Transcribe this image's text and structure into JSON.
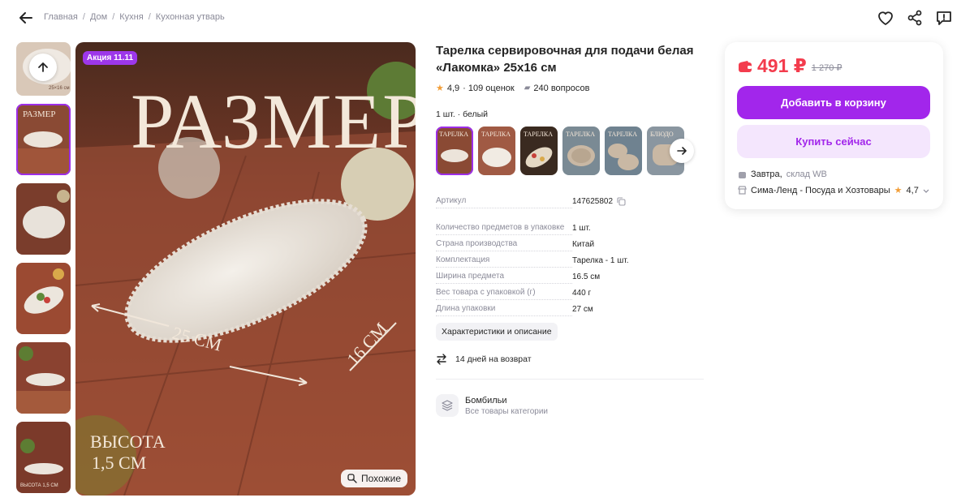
{
  "breadcrumb": {
    "items": [
      "Главная",
      "Дом",
      "Кухня",
      "Кухонная утварь"
    ]
  },
  "gallery": {
    "promo_badge": "Акция 11.11",
    "similar_label": "Похожие",
    "main_overlay": {
      "headline": "РАЗМЕР",
      "dim_length": "25 СМ",
      "dim_width": "16 СМ",
      "height_label": "ВЫСОТА",
      "height_value": "1,5 СМ"
    },
    "thumb_overlays": [
      "25×16 см",
      "РАЗМЕР",
      "ВЫСОТА 1,5 СМ"
    ]
  },
  "product": {
    "title": "Тарелка сервировочная для подачи белая «Лакомка» 25x16 см",
    "rating": "4,9",
    "reviews": "· 109 оценок",
    "questions": "240 вопросов",
    "variant_label": "1 шт. · белый",
    "variant_thumb_texts": [
      "ТАРЕЛКА",
      "ТАРЕЛКА",
      "ТАРЕЛКА",
      "ТАРЕЛКА",
      "ТАРЕЛКА",
      "БЛЮДО"
    ],
    "properties": [
      {
        "key": "Артикул",
        "value": "147625802"
      },
      {
        "key": "Количество предметов в упаковке",
        "value": "1 шт."
      },
      {
        "key": "Страна производства",
        "value": "Китай"
      },
      {
        "key": "Комплектация",
        "value": "Тарелка - 1 шт."
      },
      {
        "key": "Ширина предмета",
        "value": "16.5 см"
      },
      {
        "key": "Вес товара с упаковкой (г)",
        "value": "440 г"
      },
      {
        "key": "Длина упаковки",
        "value": "27 см"
      }
    ],
    "chars_button": "Характеристики и описание",
    "return_text": "14 дней на возврат",
    "brand_name": "Бомбильи",
    "brand_sub": "Все товары категории"
  },
  "buy": {
    "price": "491 ₽",
    "old_price": "1 270 ₽",
    "add_to_cart": "Добавить в корзину",
    "buy_now": "Купить сейчас",
    "delivery_day": "Завтра,",
    "delivery_wh": "склад WB",
    "seller_name": "Сима-Ленд - Посуда и Хозтовары",
    "seller_rating": "4,7"
  },
  "colors": {
    "accent": "#a226eb",
    "price": "#f33c4d",
    "star": "#f29e38"
  }
}
